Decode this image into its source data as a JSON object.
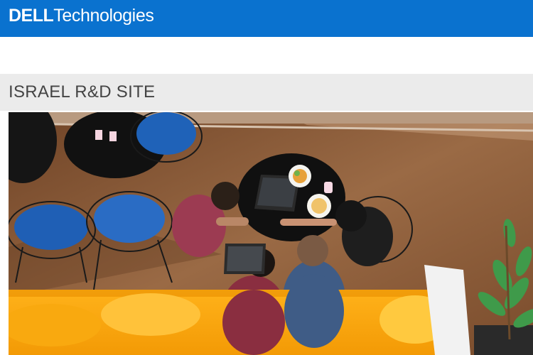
{
  "header": {
    "brand_bold": "DELL",
    "brand_light": "Technologies"
  },
  "section": {
    "title": "ISRAEL R&D SITE"
  },
  "photo": {
    "icon": "office-lounge-photo"
  }
}
